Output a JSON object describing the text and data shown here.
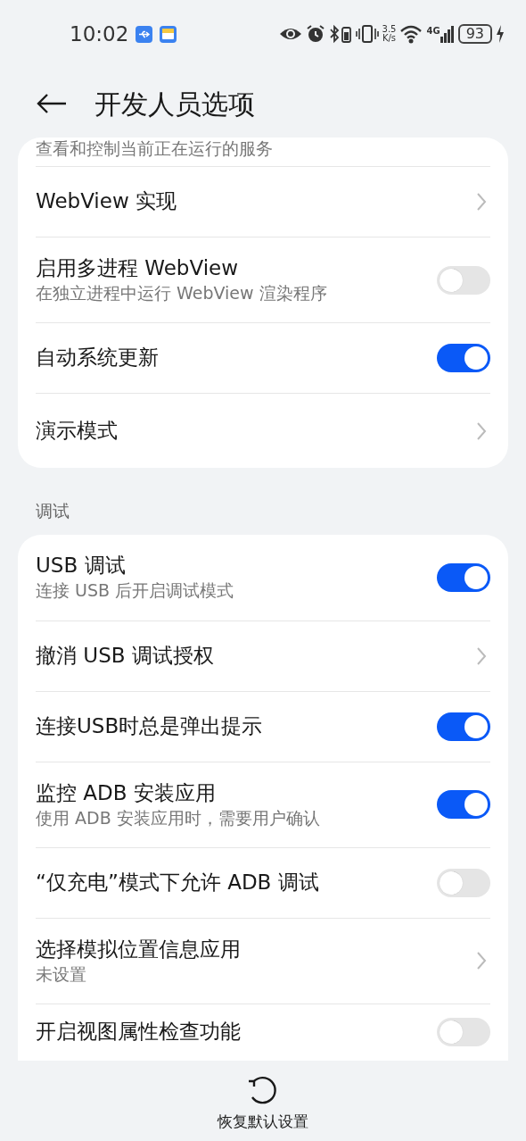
{
  "status_bar": {
    "time": "10:02",
    "speed_value": "3.5",
    "speed_unit": "K/s",
    "network": "4G",
    "battery": "93"
  },
  "header": {
    "title": "开发人员选项"
  },
  "groups": [
    {
      "items": [
        {
          "kind": "cut",
          "subtitle": "查看和控制当前正在运行的服务"
        },
        {
          "kind": "link",
          "title": "WebView 实现"
        },
        {
          "kind": "switch",
          "title": "启用多进程 WebView",
          "subtitle": "在独立进程中运行 WebView 渲染程序",
          "on": false
        },
        {
          "kind": "switch",
          "title": "自动系统更新",
          "on": true
        },
        {
          "kind": "link",
          "title": "演示模式"
        }
      ]
    },
    {
      "heading": "调试",
      "items": [
        {
          "kind": "switch",
          "title": "USB 调试",
          "subtitle": "连接 USB 后开启调试模式",
          "on": true
        },
        {
          "kind": "link",
          "title": "撤消 USB 调试授权"
        },
        {
          "kind": "switch",
          "title": "连接USB时总是弹出提示",
          "on": true
        },
        {
          "kind": "switch",
          "title": "监控 ADB 安装应用",
          "subtitle": "使用 ADB 安装应用时，需要用户确认",
          "on": true
        },
        {
          "kind": "switch",
          "title": "“仅充电”模式下允许 ADB 调试",
          "on": false
        },
        {
          "kind": "link",
          "title": "选择模拟位置信息应用",
          "subtitle": "未设置"
        },
        {
          "kind": "switch",
          "title": "开启视图属性检查功能",
          "on": false
        }
      ]
    }
  ],
  "footer": {
    "label": "恢复默认设置"
  }
}
